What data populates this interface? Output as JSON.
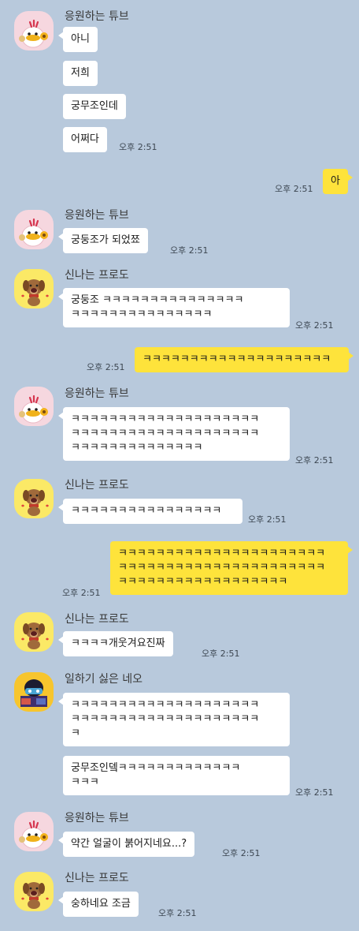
{
  "time_label": "오후 2:51",
  "senders": {
    "tube": "응원하는 튜브",
    "frodo": "신나는 프로도",
    "neo": "일하기 싫은 네오"
  },
  "messages": {
    "m1": "아니",
    "m2": "저희",
    "m3": "궁무조인데",
    "m4": "어쩌다",
    "m5": "아",
    "m6": "궁둥조가 되었쬬",
    "m7a": "궁둥조 ㅋㅋㅋㅋㅋㅋㅋㅋㅋㅋㅋㅋㅋㅋㅋ",
    "m7b": "ㅋㅋㅋㅋㅋㅋㅋㅋㅋㅋㅋㅋㅋㅋㅋ",
    "m8": "ㅋㅋㅋㅋㅋㅋㅋㅋㅋㅋㅋㅋㅋㅋㅋㅋㅋㅋㅋㅋ",
    "m9a": "ㅋㅋㅋㅋㅋㅋㅋㅋㅋㅋㅋㅋㅋㅋㅋㅋㅋㅋㅋㅋ",
    "m9b": "ㅋㅋㅋㅋㅋㅋㅋㅋㅋㅋㅋㅋㅋㅋㅋㅋㅋㅋㅋㅋ",
    "m9c": "ㅋㅋㅋㅋㅋㅋㅋㅋㅋㅋㅋㅋㅋㅋ",
    "m10": "ㅋㅋㅋㅋㅋㅋㅋㅋㅋㅋㅋㅋㅋㅋㅋㅋ",
    "m11a": "ㅋㅋㅋㅋㅋㅋㅋㅋㅋㅋㅋㅋㅋㅋㅋㅋㅋㅋㅋㅋㅋㅋ",
    "m11b": "ㅋㅋㅋㅋㅋㅋㅋㅋㅋㅋㅋㅋㅋㅋㅋㅋㅋㅋㅋㅋㅋㅋ",
    "m11c": "ㅋㅋㅋㅋㅋㅋㅋㅋㅋㅋㅋㅋㅋㅋㅋㅋㅋㅋ",
    "m12": "ㅋㅋㅋㅋ개웃겨요진짜",
    "m13a": "ㅋㅋㅋㅋㅋㅋㅋㅋㅋㅋㅋㅋㅋㅋㅋㅋㅋㅋㅋㅋ",
    "m13b": "ㅋㅋㅋㅋㅋㅋㅋㅋㅋㅋㅋㅋㅋㅋㅋㅋㅋㅋㅋㅋ",
    "m13c": "ㅋ",
    "m14a": "궁무조인뎈ㅋㅋㅋㅋㅋㅋㅋㅋㅋㅋㅋㅋㅋ",
    "m14b": "ㅋㅋㅋ",
    "m15": "약간 얼굴이 붉어지네요...?",
    "m16": "숭하네요 조금"
  },
  "avatars": {
    "tube": "tube-character-icon",
    "frodo": "frodo-dog-character-icon",
    "neo": "neo-character-icon"
  },
  "colors": {
    "background": "#b8c9dc",
    "bubble_other": "#ffffff",
    "bubble_mine": "#fee33b"
  }
}
